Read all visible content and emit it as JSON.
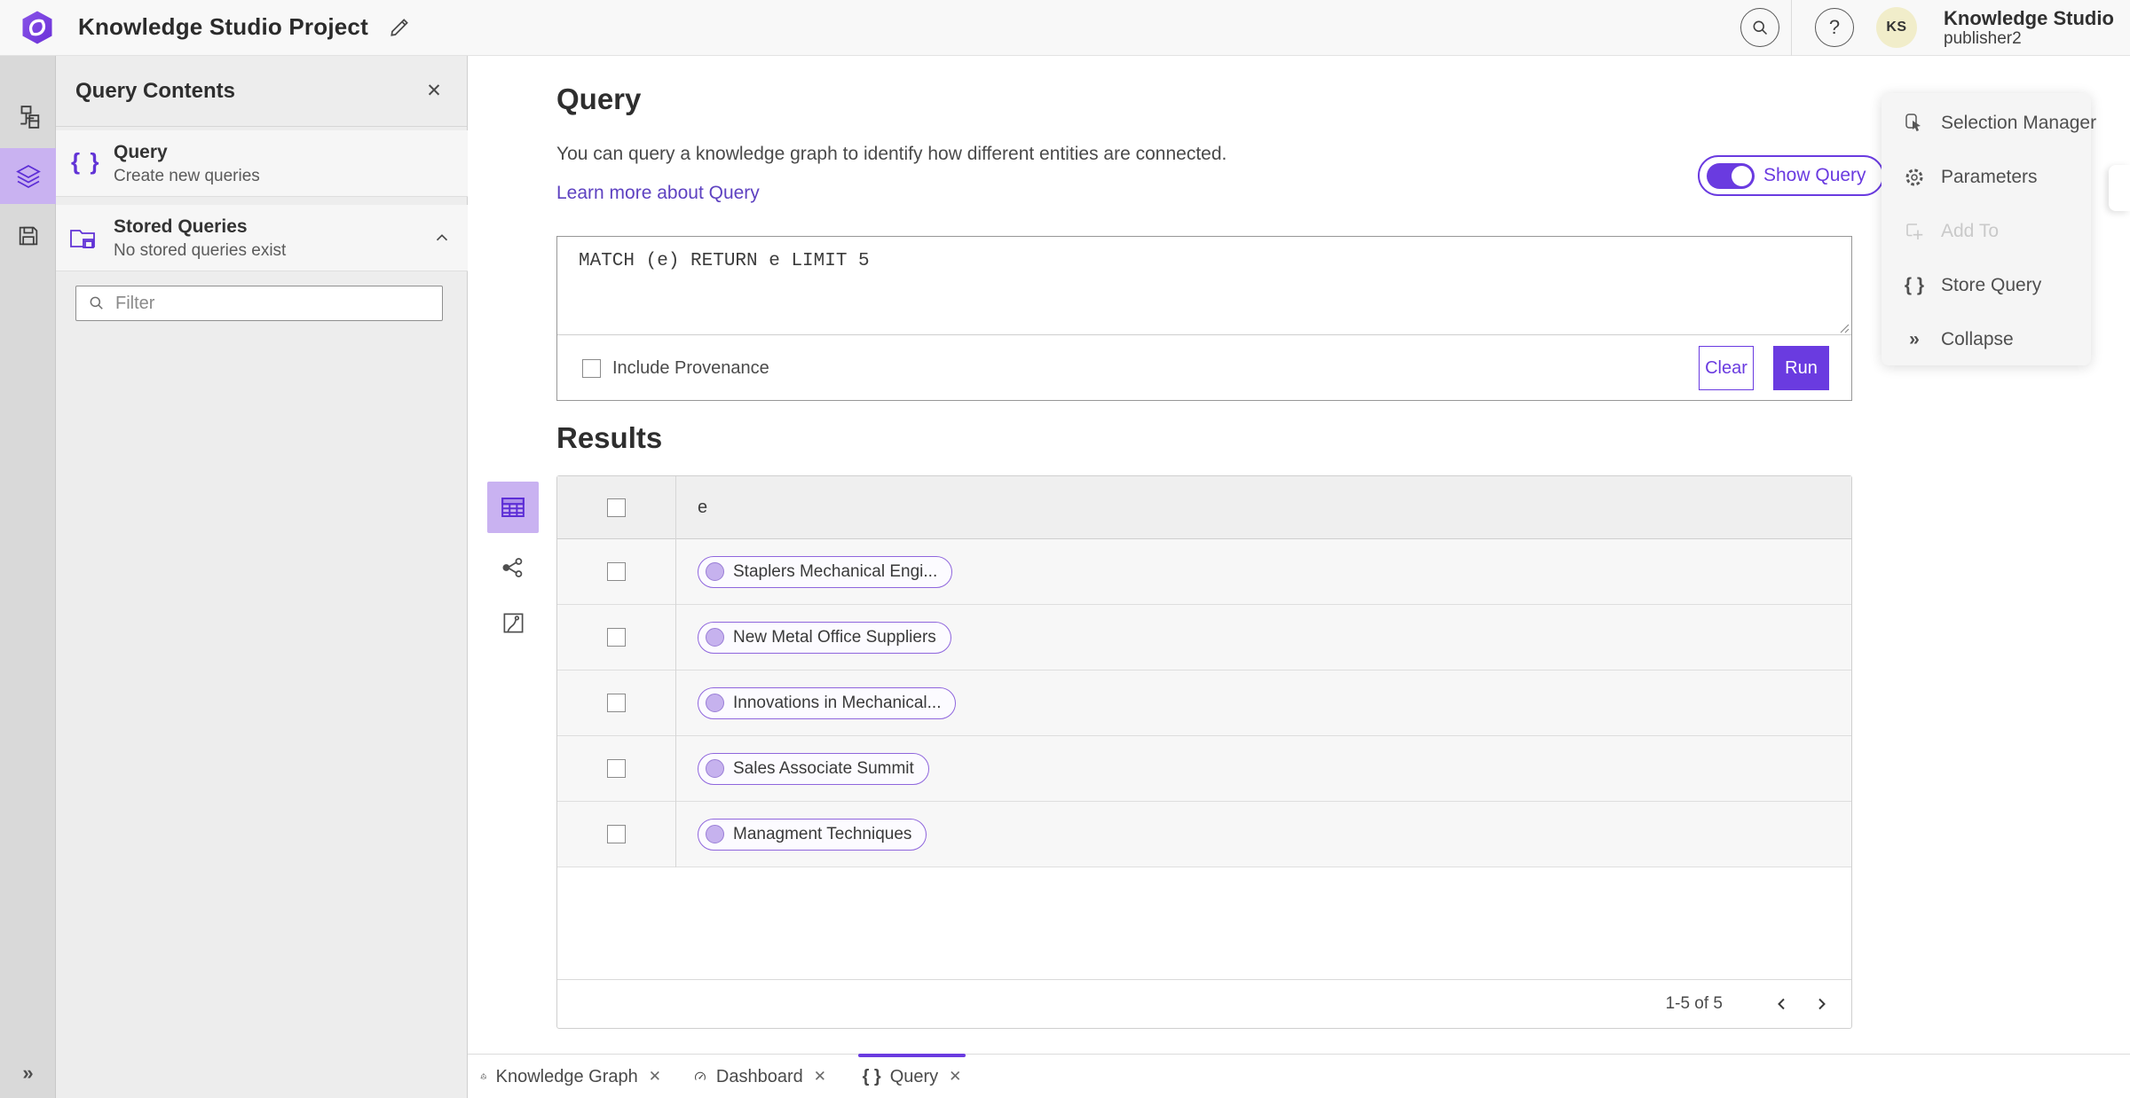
{
  "header": {
    "app_title": "Knowledge Studio Project",
    "user_name": "Knowledge Studio",
    "user_role": "publisher2",
    "avatar_initials": "KS"
  },
  "panel": {
    "title": "Query Contents",
    "query_item": {
      "title": "Query",
      "subtitle": "Create new queries"
    },
    "stored_item": {
      "title": "Stored Queries",
      "subtitle": "No stored queries exist"
    },
    "filter_placeholder": "Filter"
  },
  "query_section": {
    "heading": "Query",
    "description": "You can query a knowledge graph to identify how different entities are connected.",
    "learn_more": "Learn more about Query",
    "show_query": "Show Query",
    "query_text": "MATCH (e) RETURN e LIMIT 5",
    "include_provenance": "Include Provenance",
    "clear": "Clear",
    "run": "Run"
  },
  "results": {
    "heading": "Results",
    "column": "e",
    "rows": [
      {
        "label": "Staplers Mechanical Engi..."
      },
      {
        "label": "New Metal Office Suppliers"
      },
      {
        "label": "Innovations in Mechanical..."
      },
      {
        "label": "Sales Associate Summit"
      },
      {
        "label": "Managment Techniques"
      }
    ],
    "pagination": "1-5 of 5"
  },
  "right_menu": {
    "items": [
      {
        "label": "Selection Manager",
        "disabled": false
      },
      {
        "label": "Parameters",
        "disabled": false
      },
      {
        "label": "Add To",
        "disabled": true
      },
      {
        "label": "Store Query",
        "disabled": false
      },
      {
        "label": "Collapse",
        "disabled": false
      }
    ]
  },
  "bottom_tabs": [
    {
      "label": "Knowledge Graph"
    },
    {
      "label": "Dashboard"
    },
    {
      "label": "Query"
    }
  ],
  "glyphs": {
    "close": "✕",
    "braces": "{ }",
    "question": "?",
    "collapse": "»",
    "expand": "»"
  },
  "colors": {
    "accent": "#6a3be0",
    "accent_light": "#c9b2f1",
    "icon_purple": "#6133d6",
    "link": "#5e42c1",
    "avatar_bg": "#f1edca"
  }
}
